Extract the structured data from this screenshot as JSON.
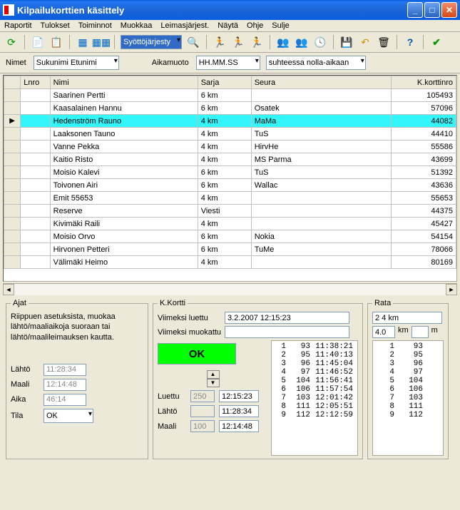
{
  "window": {
    "title": "Kilpailukorttien käsittely"
  },
  "menu": [
    "Raportit",
    "Tulokset",
    "Toiminnot",
    "Muokkaa",
    "Leimasjärjest.",
    "Näytä",
    "Ohje",
    "Sulje"
  ],
  "toolbar": {
    "highlight": "Syöttöjärjesty"
  },
  "filters": {
    "nimet_label": "Nimet",
    "nimet_value": "Sukunimi Etunimi",
    "aikamuoto_label": "Aikamuoto",
    "aikamuoto_value": "HH.MM.SS",
    "suhteessa_value": "suhteessa nolla-aikaan"
  },
  "grid": {
    "headers": {
      "lnro": "Lnro",
      "nimi": "Nimi",
      "sarja": "Sarja",
      "seura": "Seura",
      "kortti": "K.korttinro"
    },
    "rows": [
      {
        "nimi": "Saarinen Pertti",
        "sarja": "6 km",
        "seura": "",
        "kortti": "105493"
      },
      {
        "nimi": "Kaasalainen Hannu",
        "sarja": "6 km",
        "seura": "Osatek",
        "kortti": "57096"
      },
      {
        "nimi": "Hedenström Rauno",
        "sarja": "4 km",
        "seura": "MaMa",
        "kortti": "44082",
        "selected": true
      },
      {
        "nimi": "Laaksonen Tauno",
        "sarja": "4 km",
        "seura": "TuS",
        "kortti": "44410"
      },
      {
        "nimi": "Vanne Pekka",
        "sarja": "4 km",
        "seura": "HirvHe",
        "kortti": "55586"
      },
      {
        "nimi": "Kaitio Risto",
        "sarja": "4 km",
        "seura": "MS Parma",
        "kortti": "43699"
      },
      {
        "nimi": "Moisio Kalevi",
        "sarja": "6 km",
        "seura": "TuS",
        "kortti": "51392"
      },
      {
        "nimi": "Toivonen Airi",
        "sarja": "6 km",
        "seura": "Wallac",
        "kortti": "43636"
      },
      {
        "nimi": "Emit 55653",
        "sarja": "4 km",
        "seura": "",
        "kortti": "55653"
      },
      {
        "nimi": "Reserve",
        "sarja": "Viesti",
        "seura": "",
        "kortti": "44375"
      },
      {
        "nimi": "Kivimäki Raili",
        "sarja": "4 km",
        "seura": "",
        "kortti": "45427"
      },
      {
        "nimi": "Moisio Orvo",
        "sarja": "6 km",
        "seura": "Nokia",
        "kortti": "54154"
      },
      {
        "nimi": "Hirvonen Petteri",
        "sarja": "6 km",
        "seura": "TuMe",
        "kortti": "78066"
      },
      {
        "nimi": "Välimäki Heimo",
        "sarja": "4 km",
        "seura": "",
        "kortti": "80169"
      }
    ]
  },
  "ajat": {
    "legend": "Ajat",
    "info": "Riippuen asetuksista, muokaa lähtö/maaliaikoja suoraan tai lähtö/maalileimauksen kautta.",
    "lahto_label": "Lähtö",
    "lahto": "11:28:34",
    "maali_label": "Maali",
    "maali": "12:14:48",
    "aika_label": "Aika",
    "aika": "46:14",
    "tila_label": "Tila",
    "tila": "OK"
  },
  "kortti": {
    "legend": "K.Kortti",
    "viimeksi_luettu_label": "Viimeksi luettu",
    "viimeksi_luettu": "3.2.2007 12:15:23",
    "viimeksi_muokattu_label": "Viimeksi muokattu",
    "viimeksi_muokattu": "",
    "ok_label": "OK",
    "luettu_label": "Luettu",
    "luettu_n": "250",
    "luettu_t": "12:15:23",
    "lahto_label": "Lähtö",
    "lahto_n": "",
    "lahto_t": "11:28:34",
    "maali_label": "Maali",
    "maali_n": "100",
    "maali_t": "12:14:48",
    "splits": [
      {
        "i": "1",
        "code": "93",
        "t": "11:38:21"
      },
      {
        "i": "2",
        "code": "95",
        "t": "11:40:13"
      },
      {
        "i": "3",
        "code": "96",
        "t": "11:45:04"
      },
      {
        "i": "4",
        "code": "97",
        "t": "11:46:52"
      },
      {
        "i": "5",
        "code": "104",
        "t": "11:56:41"
      },
      {
        "i": "6",
        "code": "106",
        "t": "11:57:54"
      },
      {
        "i": "7",
        "code": "103",
        "t": "12:01:42"
      },
      {
        "i": "8",
        "code": "111",
        "t": "12:05:51"
      },
      {
        "i": "9",
        "code": "112",
        "t": "12:12:59"
      }
    ]
  },
  "rata": {
    "legend": "Rata",
    "course": "2 4 km",
    "dist": "4.0",
    "km": "km",
    "m": "m",
    "controls": [
      {
        "i": "1",
        "code": "93"
      },
      {
        "i": "2",
        "code": "95"
      },
      {
        "i": "3",
        "code": "96"
      },
      {
        "i": "4",
        "code": "97"
      },
      {
        "i": "5",
        "code": "104"
      },
      {
        "i": "6",
        "code": "106"
      },
      {
        "i": "7",
        "code": "103"
      },
      {
        "i": "8",
        "code": "111"
      },
      {
        "i": "9",
        "code": "112"
      }
    ]
  }
}
